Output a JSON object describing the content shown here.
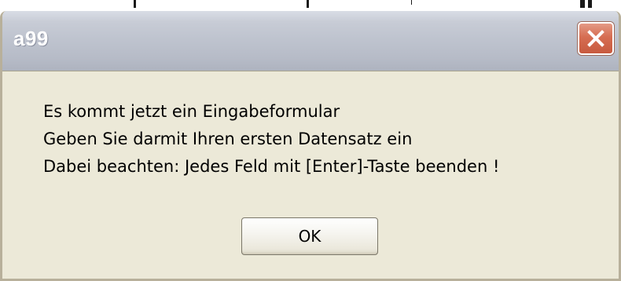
{
  "window": {
    "title": "a99"
  },
  "titlebar": {
    "close_icon": "close-icon"
  },
  "message": {
    "lines": [
      "Es kommt jetzt ein Eingabeformular",
      "Geben Sie darmit Ihren ersten Datensatz ein",
      "Dabei beachten: Jedes Feld mit [Enter]-Taste beenden !"
    ]
  },
  "buttons": {
    "ok_label": "OK"
  },
  "colors": {
    "dialog_background": "#ece9d8",
    "close_button": "#d66d52",
    "title_text": "#ffffff"
  }
}
